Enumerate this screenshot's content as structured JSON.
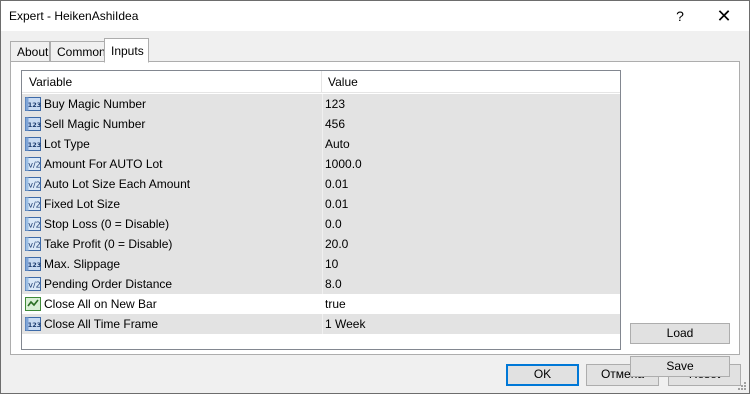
{
  "window": {
    "title": "Expert - HeikenAshiIdea",
    "help_label": "?",
    "close_label": "✕"
  },
  "tabs": [
    {
      "label": "About",
      "active": false
    },
    {
      "label": "Common",
      "active": false
    },
    {
      "label": "Inputs",
      "active": true
    }
  ],
  "inputs_table": {
    "columns": [
      "Variable",
      "Value"
    ],
    "rows": [
      {
        "icon": "integer-icon",
        "variable": "Buy Magic Number",
        "value": "123"
      },
      {
        "icon": "integer-icon",
        "variable": "Sell Magic Number",
        "value": "456"
      },
      {
        "icon": "integer-icon",
        "variable": "Lot Type",
        "value": "Auto"
      },
      {
        "icon": "double-icon",
        "variable": "Amount For AUTO Lot",
        "value": "1000.0"
      },
      {
        "icon": "double-icon",
        "variable": "Auto Lot Size Each Amount",
        "value": "0.01"
      },
      {
        "icon": "double-icon",
        "variable": "Fixed Lot Size",
        "value": "0.01"
      },
      {
        "icon": "double-icon",
        "variable": "Stop Loss (0 = Disable)",
        "value": "0.0"
      },
      {
        "icon": "double-icon",
        "variable": "Take Profit (0 = Disable)",
        "value": "20.0"
      },
      {
        "icon": "integer-icon",
        "variable": "Max. Slippage",
        "value": "10"
      },
      {
        "icon": "double-icon",
        "variable": "Pending Order Distance",
        "value": "8.0"
      },
      {
        "icon": "bool-icon",
        "variable": "Close All on New Bar",
        "value": "true"
      },
      {
        "icon": "integer-icon",
        "variable": "Close All Time Frame",
        "value": "1 Week"
      }
    ]
  },
  "side_buttons": {
    "load_label": "Load",
    "save_label": "Save"
  },
  "footer_buttons": {
    "ok_label": "OK",
    "cancel_label": "Отмена",
    "reset_label": "Reset"
  },
  "colors": {
    "row_shade": "#e3e3e3",
    "focus_border": "#0078d7",
    "button_face": "#e1e1e1"
  }
}
